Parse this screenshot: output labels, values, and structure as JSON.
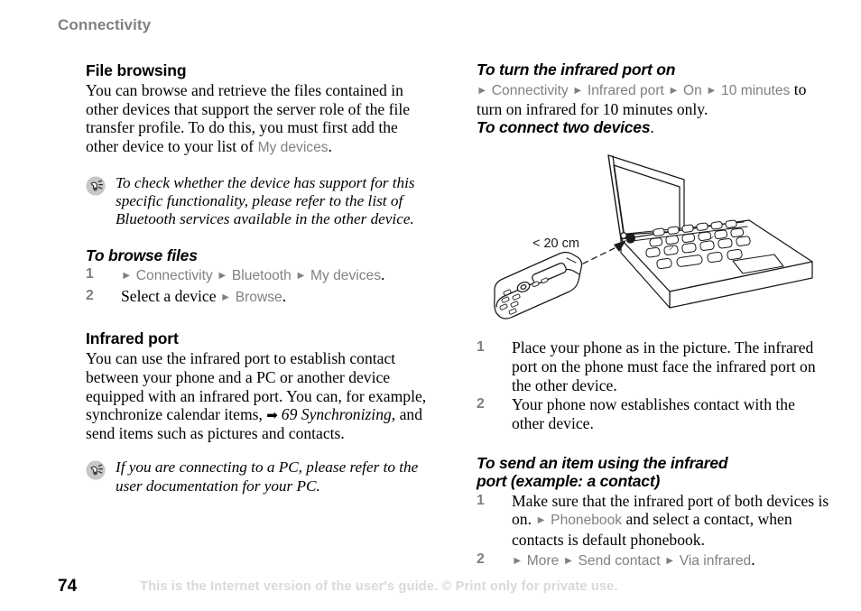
{
  "header": {
    "chapter": "Connectivity"
  },
  "footer": {
    "page_number": "74",
    "notice": "This is the Internet version of the user's guide. © Print only for private use."
  },
  "colors": {
    "ui_gray": "#808080",
    "header_gray": "#808080",
    "step_number_gray": "#7f7f7f",
    "footer_gray": "#d9d9d9",
    "body_black": "#000000"
  },
  "glyphs": {
    "path_separator": "►",
    "xref_arrow": "➡",
    "period": "."
  },
  "left_column": {
    "file_browsing": {
      "title": "File browsing",
      "paragraph_pre": "You can browse and retrieve the files contained in other devices that support the server role of the file transfer profile. To do this, you must first add the other device to your list of ",
      "paragraph_ui": "My devices",
      "paragraph_post": "."
    },
    "note_bluetooth": {
      "icon": "tip-bulb-icon",
      "text": "To check whether the device has support for this specific functionality, please refer to the list of Bluetooth services available in the other device."
    },
    "to_browse_files": {
      "title": "To browse files",
      "steps": [
        {
          "number": "1",
          "segments": [
            {
              "type": "sep"
            },
            {
              "type": "ui",
              "text": "Connectivity"
            },
            {
              "type": "sep"
            },
            {
              "type": "ui",
              "text": "Bluetooth"
            },
            {
              "type": "sep"
            },
            {
              "type": "ui",
              "text": "My devices"
            },
            {
              "type": "plain",
              "text": "."
            }
          ]
        },
        {
          "number": "2",
          "segments": [
            {
              "type": "plain",
              "text": "Select a device "
            },
            {
              "type": "sep"
            },
            {
              "type": "ui",
              "text": "Browse"
            },
            {
              "type": "plain",
              "text": "."
            }
          ]
        }
      ]
    },
    "infrared_port": {
      "title": "Infrared port",
      "paragraph_pre": "You can use the infrared port to establish contact between your phone and a PC or another device equipped with an infrared port. You can, for example, synchronize calendar items, ",
      "xref": "69 Synchronizing",
      "paragraph_post": ", and send items such as pictures and contacts."
    },
    "note_pc": {
      "icon": "tip-bulb-icon",
      "text": "If you are connecting to a PC, please refer to the user documentation for your PC."
    }
  },
  "right_column": {
    "to_turn_on": {
      "title": "To turn the infrared port on",
      "segments": [
        {
          "type": "sep"
        },
        {
          "type": "ui",
          "text": "Connectivity"
        },
        {
          "type": "sep"
        },
        {
          "type": "ui",
          "text": "Infrared port"
        },
        {
          "type": "sep"
        },
        {
          "type": "ui",
          "text": "On"
        },
        {
          "type": "sep"
        },
        {
          "type": "ui",
          "text": "10 minutes"
        },
        {
          "type": "plain",
          "text": " to turn on infrared for 10 minutes only."
        }
      ]
    },
    "to_connect": {
      "title": "To connect two devices",
      "title_period": "."
    },
    "figure": {
      "name": "infrared-connection-illustration",
      "distance_label": "< 20 cm",
      "elements": [
        "mobile-phone",
        "laptop-computer",
        "dashed-double-arrow",
        "infrared-port-marker"
      ]
    },
    "connect_steps": [
      {
        "number": "1",
        "text": "Place your phone as in the picture. The infrared port on the phone must face the infrared port on the other device."
      },
      {
        "number": "2",
        "text": "Your phone now establishes contact with the other device."
      }
    ],
    "to_send_item": {
      "title_line1": "To send an item using the infrared",
      "title_line2": "port (example: a contact)",
      "steps": [
        {
          "number": "1",
          "segments": [
            {
              "type": "plain",
              "text": "Make sure that the infrared port of both devices is on. "
            },
            {
              "type": "sep"
            },
            {
              "type": "ui",
              "text": "Phonebook"
            },
            {
              "type": "plain",
              "text": " and select a contact, when contacts is default phonebook."
            }
          ]
        },
        {
          "number": "2",
          "segments": [
            {
              "type": "sep"
            },
            {
              "type": "ui",
              "text": "More"
            },
            {
              "type": "sep"
            },
            {
              "type": "ui",
              "text": "Send contact"
            },
            {
              "type": "sep"
            },
            {
              "type": "ui",
              "text": "Via infrared"
            },
            {
              "type": "plain",
              "text": "."
            }
          ]
        }
      ]
    }
  }
}
